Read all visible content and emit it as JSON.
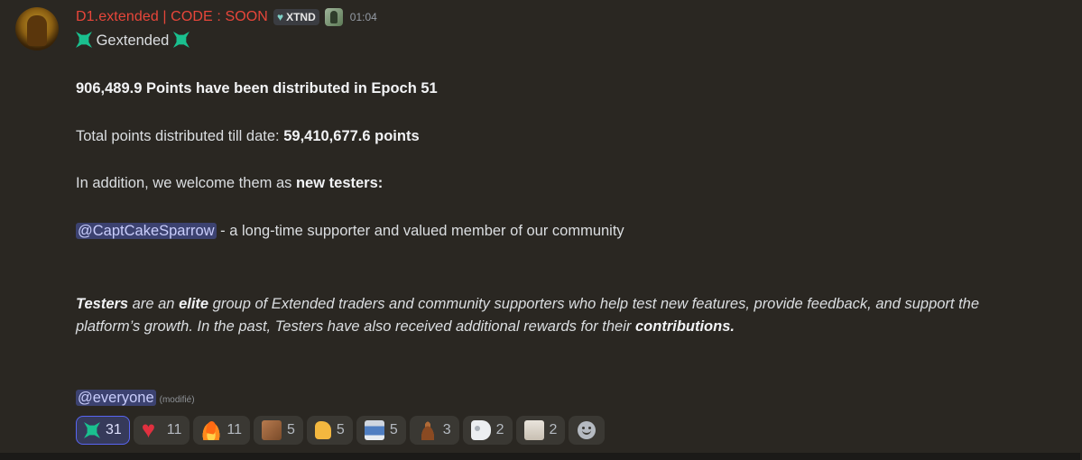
{
  "message": {
    "username": "D1.extended | CODE : SOON",
    "tag_label": "XTND",
    "time": "01:04",
    "greeting": "Gextended",
    "line_points": "906,489.9 Points have been distributed in Epoch 51",
    "total_prefix": "Total points distributed till date: ",
    "total_value": "59,410,677.6 points",
    "welcome_prefix": "In addition, we welcome them as ",
    "welcome_bold": "new testers:",
    "tester_mention": "@CaptCakeSparrow",
    "tester_desc": " - a long-time supporter and valued member of our community",
    "para_b1": "Testers",
    "para_t1": " are an ",
    "para_b2": "elite",
    "para_t2": " group of Extended traders and community supporters who help test new features, provide feedback, and support the platform’s growth. In the past, Testers have also received additional rewards for their ",
    "para_b3": "contributions.",
    "everyone_mention": "@everyone",
    "modified": "(modifié)"
  },
  "reactions": [
    {
      "emoji": "gextended-icon",
      "count": "31",
      "active": true
    },
    {
      "emoji": "red-heart-icon",
      "count": "11"
    },
    {
      "emoji": "fire-icon",
      "count": "11"
    },
    {
      "emoji": "custom-face-icon",
      "count": "5"
    },
    {
      "emoji": "thumbs-up-icon",
      "count": "5"
    },
    {
      "emoji": "printer-icon",
      "count": "5"
    },
    {
      "emoji": "poop-icon",
      "count": "3"
    },
    {
      "emoji": "toilet-roll-icon",
      "count": "2"
    },
    {
      "emoji": "cat-icon",
      "count": "2"
    }
  ],
  "colors": {
    "background": "#2a2722",
    "username": "#e8463a",
    "mention_bg": "#3c4270",
    "accent": "#5865f2"
  }
}
